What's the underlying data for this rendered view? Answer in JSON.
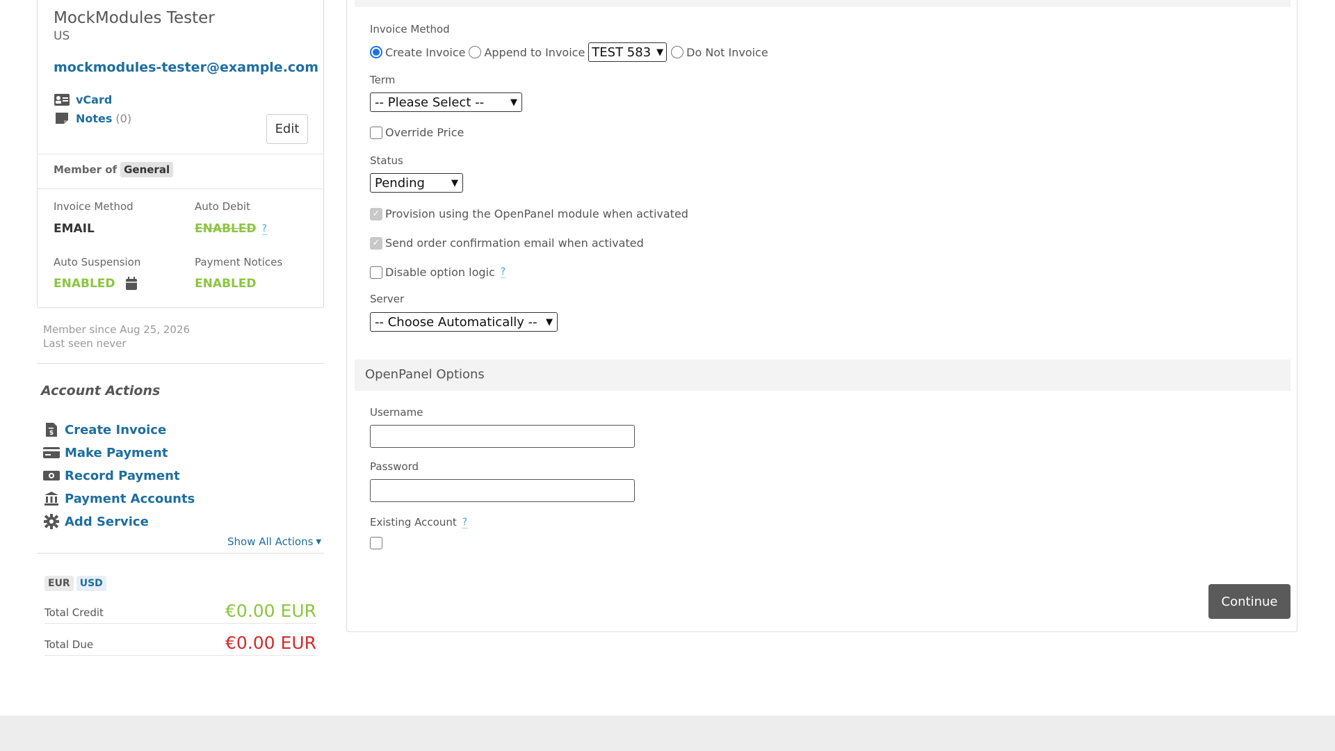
{
  "client": {
    "name": "MockModules Tester",
    "country": "US",
    "email": "mockmodules-tester@example.com",
    "vcard_label": "vCard",
    "notes_label": "Notes",
    "notes_count": "(0)",
    "edit_label": "Edit",
    "member_of_label": "Member of",
    "group": "General",
    "invoice_method_label": "Invoice Method",
    "invoice_method_value": "EMAIL",
    "auto_debit_label": "Auto Debit",
    "auto_debit_value": "ENABLED",
    "auto_suspension_label": "Auto Suspension",
    "auto_suspension_value": "ENABLED",
    "payment_notices_label": "Payment Notices",
    "payment_notices_value": "ENABLED",
    "help_mark": "?",
    "member_since": "Member since Aug 25, 2026",
    "last_seen": "Last seen never"
  },
  "actions": {
    "title": "Account Actions",
    "items": [
      {
        "label": "Create Invoice",
        "icon": "invoice-icon"
      },
      {
        "label": "Make Payment",
        "icon": "credit-card-icon"
      },
      {
        "label": "Record Payment",
        "icon": "money-icon"
      },
      {
        "label": "Payment Accounts",
        "icon": "bank-icon"
      },
      {
        "label": "Add Service",
        "icon": "gear-icon"
      }
    ],
    "show_all": "Show All Actions"
  },
  "balance": {
    "currencies": [
      "EUR",
      "USD"
    ],
    "active_currency": "USD",
    "total_credit_label": "Total Credit",
    "total_credit_value": "€0.00 EUR",
    "total_due_label": "Total Due",
    "total_due_value": "€0.00 EUR"
  },
  "form": {
    "invoice_method_label": "Invoice Method",
    "opt_create": "Create Invoice",
    "opt_append": "Append to Invoice",
    "append_invoice_value": "TEST 583",
    "opt_none": "Do Not Invoice",
    "selected_invoice_option": "Create Invoice",
    "term_label": "Term",
    "term_value": "-- Please Select --",
    "override_price_label": "Override Price",
    "status_label": "Status",
    "status_value": "Pending",
    "provision_label": "Provision using the OpenPanel module when activated",
    "send_confirmation_label": "Send order confirmation email when activated",
    "disable_option_logic_label": "Disable option logic",
    "help_mark": "?",
    "server_label": "Server",
    "server_value": "-- Choose Automatically --"
  },
  "module_options": {
    "title": "OpenPanel Options",
    "username_label": "Username",
    "username_value": "",
    "password_label": "Password",
    "password_value": "",
    "existing_account_label": "Existing Account",
    "help_mark": "?"
  },
  "continue_label": "Continue",
  "colors": {
    "link": "#1d6ea0",
    "enabled_green": "#8cc540",
    "due_red": "#d42a2a",
    "continue_bg": "#5a5a5a"
  }
}
